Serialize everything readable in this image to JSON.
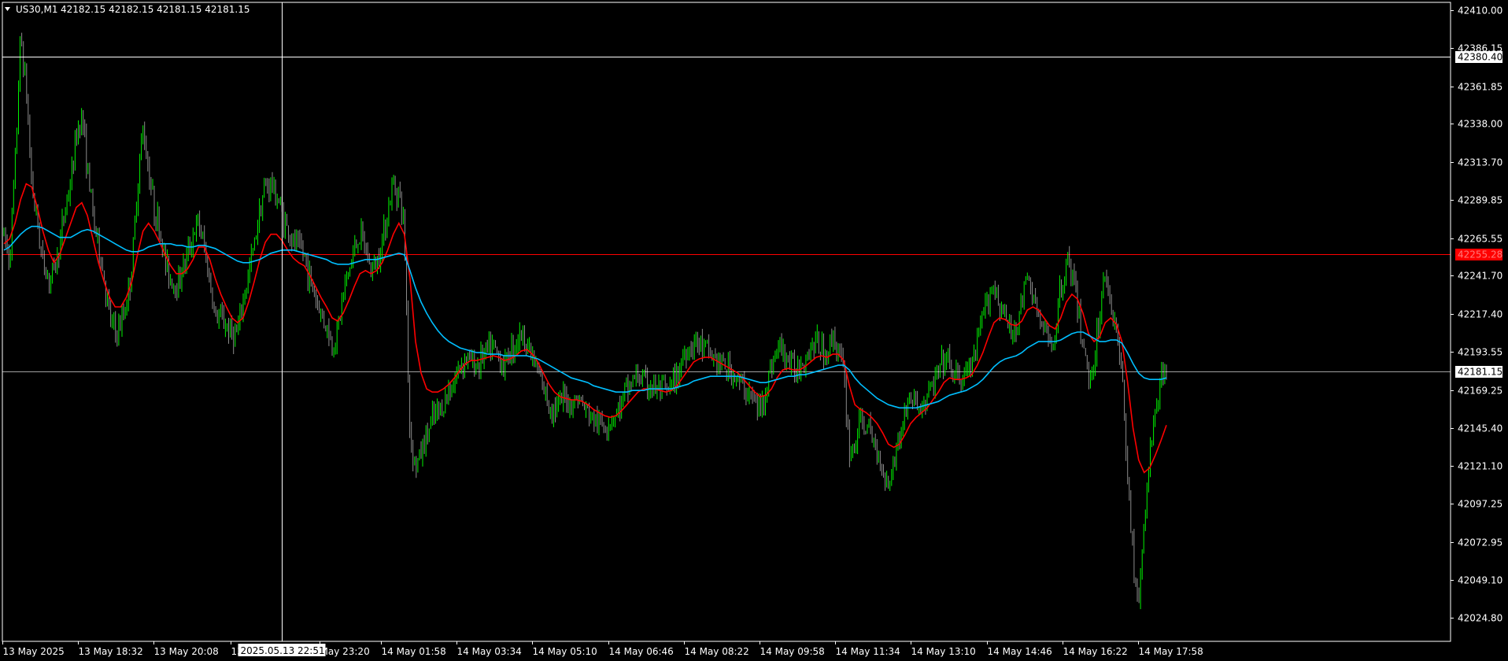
{
  "header": {
    "symbol": "US30,M1",
    "ohlc": "42182.15 42182.15 42181.15 42181.15"
  },
  "colors": {
    "background": "#000000",
    "frame": "#ffffff",
    "bull_candle": "#00ff00",
    "bear_candle": "#ffffff",
    "ma_fast": "#ff0000",
    "ma_slow": "#00bfff",
    "hline_red": "#ff0000",
    "hline_white": "#ffffff",
    "hline_gray": "#a0a0a0"
  },
  "chart_data": {
    "type": "line",
    "ylim": [
      42010.0,
      42415.0
    ],
    "y_ticks": [
      "42410.00",
      "42386.15",
      "42361.85",
      "42338.00",
      "42313.70",
      "42289.85",
      "42265.55",
      "42241.70",
      "42217.40",
      "42193.55",
      "42169.25",
      "42145.40",
      "42121.10",
      "42097.25",
      "42072.95",
      "42049.10",
      "42024.80"
    ],
    "x_ticks": [
      "13 May 2025",
      "13 May 18:32",
      "13 May 20:08",
      "13",
      "May 23:20",
      "14 May 01:58",
      "14 May 03:34",
      "14 May 05:10",
      "14 May 06:46",
      "14 May 08:22",
      "14 May 09:58",
      "14 May 11:34",
      "14 May 13:10",
      "14 May 14:46",
      "14 May 16:22",
      "14 May 17:58"
    ],
    "crosshair": {
      "price_label": "42380.40",
      "price": 42380.4,
      "time_label": "2025.05.13 22:51"
    },
    "levels": [
      {
        "name": "red-level",
        "price": 42255.28,
        "label": "42255.28",
        "color": "#ff0000"
      },
      {
        "name": "current-price",
        "price": 42181.15,
        "label": "42181.15",
        "color": "#a0a0a0"
      }
    ],
    "series": [
      {
        "type": "price",
        "values": [
          42268,
          42252,
          42310,
          42395,
          42360,
          42300,
          42275,
          42250,
          42240,
          42245,
          42260,
          42285,
          42300,
          42330,
          42345,
          42310,
          42280,
          42260,
          42240,
          42215,
          42205,
          42210,
          42225,
          42245,
          42300,
          42335,
          42310,
          42285,
          42270,
          42250,
          42240,
          42235,
          42245,
          42255,
          42268,
          42275,
          42260,
          42238,
          42215,
          42215,
          42210,
          42205,
          42205,
          42225,
          42243,
          42262,
          42285,
          42298,
          42300,
          42292,
          42282,
          42270,
          42262,
          42260,
          42255,
          42240,
          42228,
          42218,
          42210,
          42196,
          42208,
          42230,
          42245,
          42258,
          42268,
          42258,
          42245,
          42250,
          42265,
          42282,
          42300,
          42295,
          42270,
          42140,
          42120,
          42130,
          42140,
          42150,
          42155,
          42160,
          42170,
          42175,
          42185,
          42190,
          42188,
          42185,
          42190,
          42194,
          42196,
          42190,
          42185,
          42195,
          42200,
          42205,
          42200,
          42190,
          42180,
          42170,
          42160,
          42158,
          42160,
          42165,
          42160,
          42165,
          42160,
          42155,
          42150,
          42148,
          42147,
          42150,
          42154,
          42160,
          42170,
          42175,
          42178,
          42175,
          42172,
          42170,
          42170,
          42168,
          42170,
          42178,
          42190,
          42195,
          42200,
          42198,
          42195,
          42192,
          42188,
          42185,
          42183,
          42180,
          42175,
          42170,
          42168,
          42160,
          42158,
          42170,
          42185,
          42195,
          42195,
          42188,
          42182,
          42185,
          42190,
          42196,
          42200,
          42195,
          42190,
          42205,
          42195,
          42180,
          42130,
          42135,
          42150,
          42145,
          42140,
          42130,
          42120,
          42110,
          42125,
          42140,
          42155,
          42165,
          42160,
          42158,
          42165,
          42172,
          42180,
          42188,
          42185,
          42178,
          42175,
          42180,
          42185,
          42198,
          42215,
          42230,
          42235,
          42225,
          42215,
          42205,
          42210,
          42225,
          42240,
          42230,
          42215,
          42205,
          42200,
          42205,
          42235,
          42250,
          42245,
          42220,
          42200,
          42175,
          42190,
          42215,
          42245,
          42225,
          42205,
          42180,
          42120,
          42060,
          42035,
          42080,
          42130,
          42155,
          42172,
          42184
        ]
      },
      {
        "type": "ma",
        "name": "",
        "color": "#ff0000",
        "values": [
          42262,
          42265,
          42275,
          42290,
          42300,
          42298,
          42285,
          42270,
          42258,
          42250,
          42255,
          42265,
          42275,
          42285,
          42288,
          42280,
          42265,
          42250,
          42238,
          42228,
          42222,
          42222,
          42228,
          42238,
          42255,
          42270,
          42275,
          42270,
          42263,
          42255,
          42248,
          42243,
          42243,
          42246,
          42252,
          42260,
          42260,
          42252,
          42240,
          42230,
          42222,
          42215,
          42212,
          42215,
          42225,
          42238,
          42252,
          42263,
          42268,
          42268,
          42264,
          42258,
          42253,
          42250,
          42248,
          42242,
          42235,
          42228,
          42222,
          42215,
          42213,
          42218,
          42226,
          42235,
          42243,
          42245,
          42243,
          42245,
          42250,
          42258,
          42268,
          42275,
          42268,
          42240,
          42200,
          42180,
          42170,
          42168,
          42168,
          42170,
          42173,
          42177,
          42182,
          42186,
          42188,
          42188,
          42189,
          42190,
          42191,
          42190,
          42188,
          42189,
          42191,
          42194,
          42195,
          42192,
          42187,
          42180,
          42173,
          42168,
          42165,
          42164,
          42163,
          42163,
          42162,
          42160,
          42157,
          42155,
          42153,
          42152,
          42153,
          42156,
          42160,
          42164,
          42168,
          42170,
          42170,
          42170,
          42169,
          42168,
          42169,
          42172,
          42177,
          42182,
          42187,
          42189,
          42190,
          42190,
          42188,
          42186,
          42184,
          42182,
          42180,
          42176,
          42172,
          42168,
          42165,
          42166,
          42170,
          42177,
          42182,
          42183,
          42182,
          42182,
          42184,
          42187,
          42190,
          42191,
          42190,
          42192,
          42192,
          42188,
          42172,
          42160,
          42157,
          42155,
          42152,
          42148,
          42142,
          42135,
          42133,
          42135,
          42141,
          42148,
          42152,
          42155,
          42158,
          42163,
          42168,
          42174,
          42177,
          42176,
          42176,
          42177,
          42179,
          42185,
          42193,
          42203,
          42212,
          42215,
          42214,
          42211,
          42210,
          42213,
          42220,
          42222,
          42220,
          42215,
          42210,
          42208,
          42215,
          42225,
          42230,
          42227,
          42218,
          42205,
          42200,
          42203,
          42212,
          42215,
          42211,
          42200,
          42175,
          42145,
          42125,
          42117,
          42120,
          42128,
          42137,
          42147
        ]
      },
      {
        "type": "ma",
        "name": "",
        "color": "#00bfff",
        "values": [
          42258,
          42260,
          42264,
          42268,
          42271,
          42273,
          42273,
          42272,
          42270,
          42268,
          42266,
          42266,
          42266,
          42268,
          42270,
          42271,
          42270,
          42268,
          42266,
          42264,
          42262,
          42260,
          42258,
          42257,
          42257,
          42258,
          42260,
          42261,
          42262,
          42262,
          42262,
          42261,
          42261,
          42260,
          42260,
          42261,
          42261,
          42260,
          42259,
          42257,
          42255,
          42253,
          42251,
          42250,
          42250,
          42251,
          42252,
          42254,
          42256,
          42257,
          42258,
          42258,
          42258,
          42257,
          42256,
          42255,
          42254,
          42253,
          42252,
          42250,
          42249,
          42249,
          42249,
          42250,
          42251,
          42252,
          42252,
          42252,
          42253,
          42254,
          42255,
          42256,
          42255,
          42245,
          42234,
          42225,
          42218,
          42212,
          42207,
          42203,
          42200,
          42198,
          42196,
          42195,
          42194,
          42193,
          42193,
          42192,
          42192,
          42192,
          42191,
          42191,
          42191,
          42191,
          42191,
          42190,
          42189,
          42187,
          42185,
          42183,
          42181,
          42179,
          42177,
          42176,
          42175,
          42174,
          42172,
          42171,
          42170,
          42169,
          42168,
          42168,
          42168,
          42169,
          42169,
          42169,
          42170,
          42170,
          42170,
          42170,
          42170,
          42171,
          42172,
          42173,
          42175,
          42176,
          42177,
          42178,
          42178,
          42178,
          42178,
          42178,
          42178,
          42177,
          42176,
          42175,
          42174,
          42174,
          42175,
          42176,
          42177,
          42178,
          42178,
          42179,
          42179,
          42180,
          42181,
          42182,
          42183,
          42184,
          42185,
          42185,
          42182,
          42177,
          42173,
          42170,
          42167,
          42164,
          42162,
          42160,
          42159,
          42158,
          42158,
          42158,
          42158,
          42159,
          42160,
          42161,
          42162,
          42164,
          42166,
          42167,
          42168,
          42169,
          42171,
          42173,
          42176,
          42180,
          42184,
          42187,
          42189,
          42190,
          42191,
          42193,
          42196,
          42198,
          42200,
          42200,
          42200,
          42200,
          42201,
          42203,
          42205,
          42206,
          42206,
          42204,
          42202,
          42200,
          42200,
          42201,
          42201,
          42199,
          42193,
          42186,
          42180,
          42177,
          42176,
          42176,
          42176,
          42177
        ]
      }
    ]
  }
}
